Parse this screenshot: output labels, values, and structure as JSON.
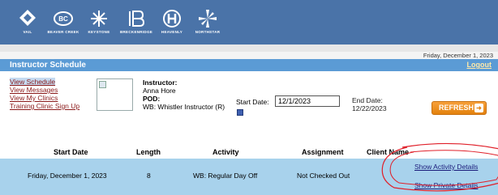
{
  "brands": [
    {
      "name": "VAIL"
    },
    {
      "name": "BEAVER CREEK"
    },
    {
      "name": "KEYSTONE"
    },
    {
      "name": "BRECKENRIDGE"
    },
    {
      "name": "HEAVENLY"
    },
    {
      "name": "NORTHSTAR"
    }
  ],
  "header": {
    "date": "Friday, December 1, 2023",
    "title": "Instructor Schedule",
    "logout": "Logout"
  },
  "nav": {
    "items": [
      {
        "label": "View Schedule"
      },
      {
        "label": "View Messages"
      },
      {
        "label": "View My Clinics"
      },
      {
        "label": "Training Clinic Sign Up"
      }
    ]
  },
  "instructor": {
    "label": "Instructor:",
    "name": "Anna Hore",
    "pod_label": "POD:",
    "pod": "WB: Whistler Instructor (R)"
  },
  "dates": {
    "start_label": "Start Date:",
    "start_value": "12/1/2023",
    "end_label": "End Date:",
    "end_value": "12/22/2023",
    "refresh": "REFRESH"
  },
  "table": {
    "columns": [
      "Start Date",
      "Length",
      "Activity",
      "Assignment",
      "Client Name"
    ],
    "rows": [
      {
        "start_date": "Friday, December 1, 2023",
        "length": "8",
        "activity": "WB: Regular Day Off",
        "assignment": "Not Checked Out",
        "client_name": "",
        "link_activity": "Show Activity Details",
        "link_private": "Show Private Details"
      }
    ]
  },
  "colors": {
    "brand_bar": "#4a73a8",
    "title_bar": "#5b9bd5",
    "row_bg": "#a8d2ec",
    "refresh_orange": "#f39a2b",
    "link_red": "#8b1a1a",
    "annotation": "#e0202a"
  }
}
